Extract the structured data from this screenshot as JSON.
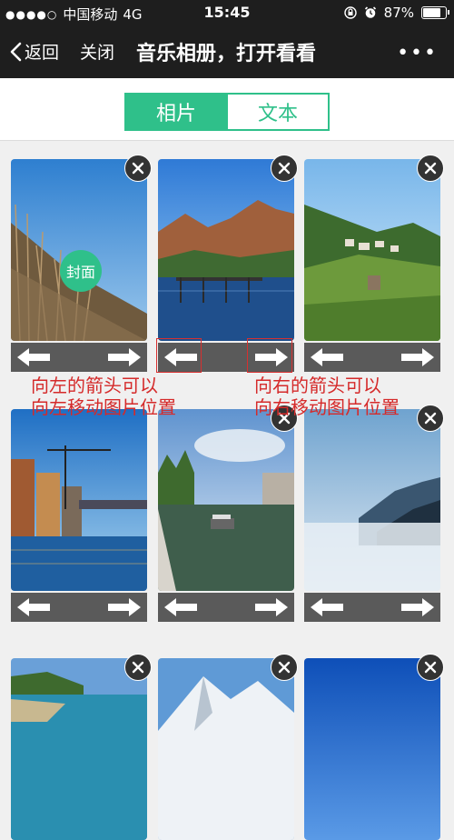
{
  "status_bar": {
    "signal": "●●●●○",
    "carrier": "中国移动",
    "network": "4G",
    "time": "15:45",
    "battery": "87%",
    "battery_level": 0.87
  },
  "nav": {
    "back_label": "返回",
    "close_label": "关闭",
    "title": "音乐相册，打开看看",
    "more_label": "•••"
  },
  "tabs": [
    {
      "label": "相片",
      "active": true
    },
    {
      "label": "文本",
      "active": false
    }
  ],
  "cover_badge": "封面",
  "annotations": {
    "left": "向左的箭头可以\n向左移动图片位置",
    "right": "向右的箭头可以\n向右移动图片位置"
  },
  "photos": [
    {
      "subject": "reeds-field"
    },
    {
      "subject": "mountain-lake-pier"
    },
    {
      "subject": "green-valley-village"
    },
    {
      "subject": "city-river-reflection"
    },
    {
      "subject": "river-boat-city"
    },
    {
      "subject": "misty-mountain"
    },
    {
      "subject": "coastline"
    },
    {
      "subject": "snowy-peak"
    },
    {
      "subject": "blue-sky"
    }
  ],
  "colors": {
    "accent": "#2fc08a",
    "bar": "#1e1e1e",
    "control": "#5a5a5a",
    "annotation": "#d52a2a"
  }
}
